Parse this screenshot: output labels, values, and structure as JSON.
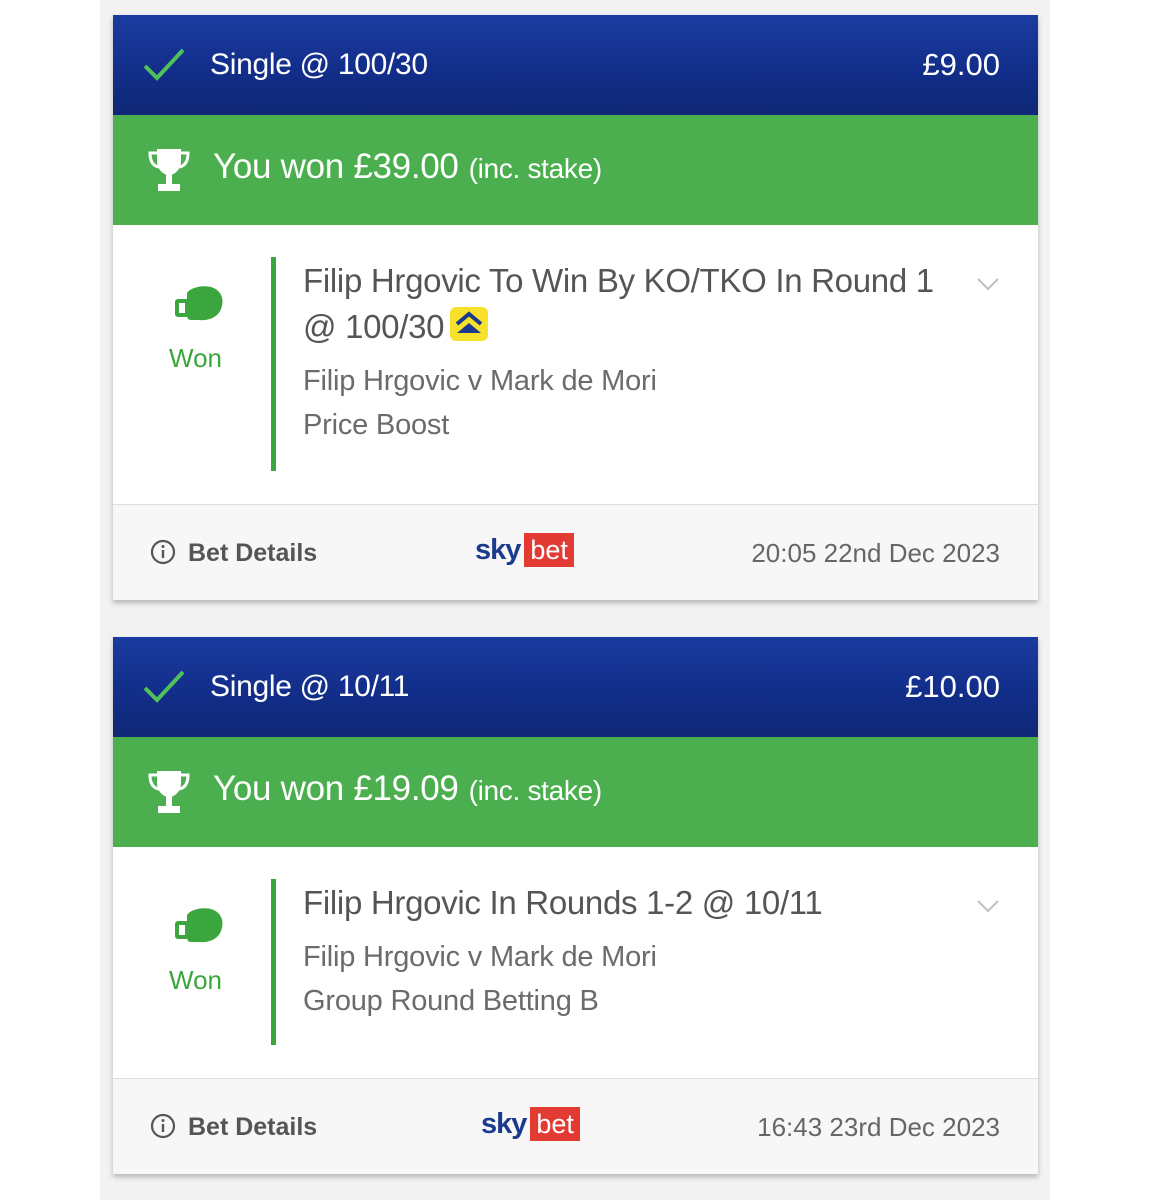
{
  "bets": [
    {
      "status_icon": "check-icon",
      "title": "Single @ 100/30",
      "stake": "£9.00",
      "won_text": "You won £39.00",
      "won_suffix": "(inc. stake)",
      "result_label": "Won",
      "selection_line1": "Filip Hrgovic To Win By KO/TKO In Round 1",
      "selection_line2": "@ 100/30",
      "event": "Filip Hrgovic v Mark de Mori",
      "market": "Price Boost",
      "footer_label": "Bet Details",
      "brand_sky": "sky",
      "brand_bet": "bet",
      "timestamp": "20:05 22nd Dec 2023",
      "price_boost_icon": "price-boost-icon"
    },
    {
      "status_icon": "check-icon",
      "title": "Single @ 10/11",
      "stake": "£10.00",
      "won_text": "You won £19.09",
      "won_suffix": "(inc. stake)",
      "result_label": "Won",
      "selection_line1": "Filip Hrgovic In Rounds 1-2 @ 10/11",
      "event": "Filip Hrgovic v Mark de Mori",
      "market": "Group Round Betting B",
      "footer_label": "Bet Details",
      "brand_sky": "sky",
      "brand_bet": "bet",
      "timestamp": "16:43 23rd Dec 2023"
    }
  ],
  "colors": {
    "header_blue": "#122e8a",
    "won_green": "#4caf4f",
    "result_green": "#3aa63d",
    "sky_blue": "#1b3a8e",
    "bet_red": "#e23b33",
    "boost_yellow": "#f7e12b"
  }
}
